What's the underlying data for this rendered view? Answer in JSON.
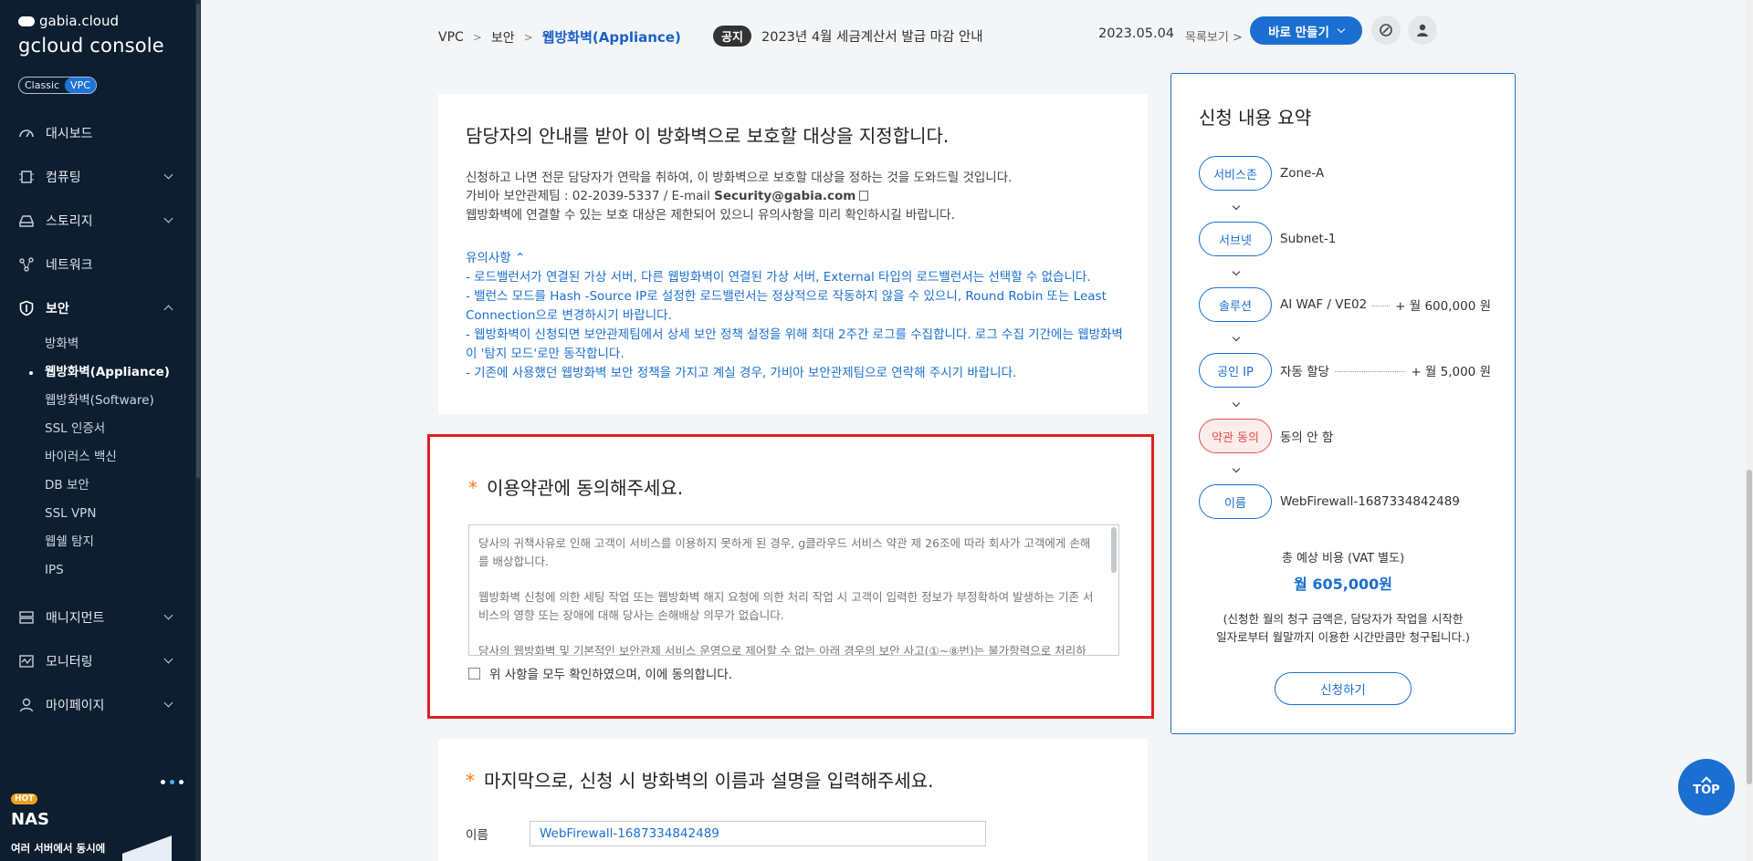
{
  "sidebar": {
    "brand_top": "gabia.cloud",
    "brand_main": "gcloud console",
    "toggle": [
      "Classic",
      "VPC"
    ],
    "nav": [
      {
        "label": "대시보드",
        "icon": "dashboard-icon"
      },
      {
        "label": "컴퓨팅",
        "icon": "cpu-icon"
      },
      {
        "label": "스토리지",
        "icon": "storage-icon"
      },
      {
        "label": "네트워크",
        "icon": "network-icon"
      },
      {
        "label": "보안",
        "icon": "shield-icon"
      },
      {
        "label": "매니지먼트",
        "icon": "management-icon"
      },
      {
        "label": "모니터링",
        "icon": "monitor-icon"
      },
      {
        "label": "마이페이지",
        "icon": "user-icon"
      }
    ],
    "security_sub": [
      "방화벽",
      "웹방화벽(Appliance)",
      "웹방화벽(Software)",
      "SSL 인증서",
      "바이러스 백신",
      "DB 보안",
      "SSL VPN",
      "웹쉘 탐지",
      "IPS"
    ],
    "promo": {
      "badge": "HOT",
      "title": "NAS",
      "sub": "여러 서버에서 동시에"
    }
  },
  "topbar": {
    "breadcrumb": [
      "VPC",
      "보안",
      "웹방화벽(Appliance)"
    ],
    "notice_tag": "공지",
    "notice_text": "2023년 4월 세금계산서 발급 마감 안내",
    "notice_date": "2023.05.04",
    "notice_more": "목록보기",
    "make_button": "바로 만들기"
  },
  "target_section": {
    "title": "담당자의 안내를 받아 이 방화벽으로 보호할 대상을 지정합니다.",
    "line1": "신청하고 나면 전문 담당자가 연락을 취하여, 이 방화벽으로 보호할 대상을 정하는 것을 도와드릴 것입니다.",
    "line2_prefix": "가비아 보안관제팀 : 02-2039-5337 / E-mail ",
    "line2_email": "Security@gabia.com",
    "line3": "웹방화벽에 연결할 수 있는 보호 대상은 제한되어 있으니 유의사항을 미리 확인하시길 바랍니다.",
    "caution_title": "유의사항",
    "cautions": [
      "- 로드밸런서가 연결된 가상 서버, 다른 웹방화벽이 연결된 가상 서버, External 타입의 로드밸런서는 선택할 수 없습니다.",
      "- 밸런스 모드를 Hash -Source IP로 설정한 로드밸런서는 정상적으로 작동하지 않을 수 있으니, Round Robin 또는 Least Connection으로 변경하시기 바랍니다.",
      "- 웹방화벽이 신청되면 보안관제팀에서 상세 보안 정책 설정을 위해 최대 2주간 로그를 수집합니다. 로그 수집 기간에는 웹방화벽이 '탐지 모드'로만 동작합니다.",
      "- 기존에 사용했던 웹방화벽 보안 정책을 가지고 계실 경우, 가비아 보안관제팀으로 연락해 주시기 바랍니다."
    ]
  },
  "terms_section": {
    "title": "이용약관에 동의해주세요.",
    "paragraphs": [
      "당사의 귀책사유로 인해 고객이 서비스를 이용하지 못하게 된 경우, g클라우드 서비스 약관 제 26조에 따라 회사가 고객에게 손해를 배상합니다.",
      "웹방화벽 신청에 의한 세팅 작업 또는 웹방화벽 해지 요청에 의한 처리 작업 시 고객이 입력한 정보가 부정확하여 발생하는 기존 서비스의 영향 또는 장애에 대해 당사는 손해배상 의무가 없습니다.",
      "당사의 웹방화벽 및 기본적인 보안관제 서비스 운영으로 제어할 수 없는 아래 경우의 보안 사고(①~⑧번)는 불가항력으로 처리하며,"
    ],
    "agree_label": "위 사항을 모두 확인하였으며, 이에 동의합니다."
  },
  "name_section": {
    "title": "마지막으로, 신청 시 방화벽의 이름과 설명을 입력해주세요.",
    "name_label": "이름",
    "name_value": "WebFirewall-1687334842489"
  },
  "summary": {
    "title": "신청 내용 요약",
    "rows": [
      {
        "label": "서비스존",
        "value": "Zone-A",
        "price": ""
      },
      {
        "label": "서브넷",
        "value": "Subnet-1",
        "price": ""
      },
      {
        "label": "솔루션",
        "value": "AI WAF / VE02",
        "price": "+ 월 600,000 원"
      },
      {
        "label": "공인 IP",
        "value": "자동 할당",
        "price": "+ 월 5,000 원"
      },
      {
        "label": "약관 동의",
        "value": "동의 안 함",
        "price": ""
      },
      {
        "label": "이름",
        "value": "WebFirewall-1687334842489",
        "price": ""
      }
    ],
    "total_label": "총 예상 비용 (VAT 별도)",
    "total_value": "월 605,000원",
    "note1": "(신청한 월의 청구 금액은, 담당자가 작업을 시작한",
    "note2": "일자로부터 월말까지 이용한 시간만큼만 청구됩니다.)",
    "apply_button": "신청하기"
  },
  "top_button": "TOP",
  "colors": {
    "accent": "#1a6fd1",
    "sidebar": "#0c1e30",
    "highlight": "#e02020"
  }
}
